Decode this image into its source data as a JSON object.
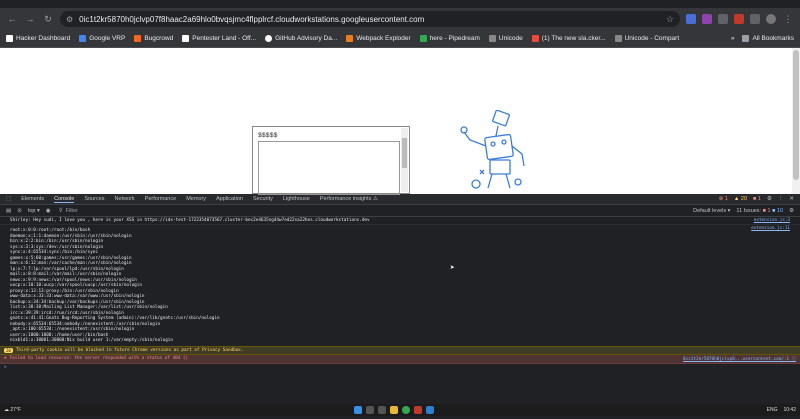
{
  "browser": {
    "url": "0ic1t2kr5870h0jclvp07f8haac2a69hlo0bvqsjmc4flpplrcf.cloudworkstations.googleusercontent.com",
    "bookmarks": [
      {
        "label": "Hacker Dashboard",
        "color": "#ffffff"
      },
      {
        "label": "Google VRP",
        "color": "#4285f4"
      },
      {
        "label": "Bugcrowd",
        "color": "#f26822"
      },
      {
        "label": "Pentester Land - Off...",
        "color": "#ffffff"
      },
      {
        "label": "GitHub Advisory Da...",
        "color": "#ffffff"
      },
      {
        "label": "Webpack Exploder",
        "color": "#e67e22"
      },
      {
        "label": "here - Pipedream",
        "color": "#34a853"
      },
      {
        "label": "Unicode",
        "color": "#888888"
      },
      {
        "label": "(1) The new sla.cker...",
        "color": "#e74c3c"
      },
      {
        "label": "Unicode - Compart",
        "color": "#888888"
      }
    ],
    "all_bookmarks": "All Bookmarks"
  },
  "page": {
    "textbox_label": "$$$$$"
  },
  "devtools": {
    "tabs": [
      "Elements",
      "Console",
      "Sources",
      "Network",
      "Performance",
      "Memory",
      "Application",
      "Security",
      "Lighthouse",
      "Performance insights ⚠"
    ],
    "active_tab": "Console",
    "counts": {
      "errors": "1",
      "warnings": "20",
      "issues_badge": "1"
    },
    "context": "top",
    "filter_placeholder": "Filter",
    "levels": "Default levels ▾",
    "issues": "11 Issues:",
    "issues_err": "1",
    "issues_info": "10",
    "log_line": "Shirley: Hey sudi, I love you , here is your XSS in https://idx-test-1722354873567.cluster-bec2e4635ng44w7ed22sa22hes.cloudworkstations.dev",
    "log_source_1": "extension.js:3",
    "log_source_2": "extension.js:11",
    "passwd": "root:x:0:0:root:/root:/bin/bash\ndaemon:x:1:1:daemon:/usr/sbin:/usr/sbin/nologin\nbin:x:2:2:bin:/bin:/usr/sbin/nologin\nsys:x:3:3:sys:/dev:/usr/sbin/nologin\nsync:x:4:65534:sync:/bin:/bin/sync\ngames:x:5:60:games:/usr/games:/usr/sbin/nologin\nman:x:6:12:man:/var/cache/man:/usr/sbin/nologin\nlp:x:7:7:lp:/var/spool/lpd:/usr/sbin/nologin\nmail:x:8:8:mail:/var/mail:/usr/sbin/nologin\nnews:x:9:9:news:/var/spool/news:/usr/sbin/nologin\nuucp:x:10:10:uucp:/var/spool/uucp:/usr/sbin/nologin\nproxy:x:13:13:proxy:/bin:/usr/sbin/nologin\nwww-data:x:33:33:www-data:/var/www:/usr/sbin/nologin\nbackup:x:34:34:backup:/var/backups:/usr/sbin/nologin\nlist:x:38:38:Mailing List Manager:/var/list:/usr/sbin/nologin\nirc:x:39:39:ircd:/run/ircd:/usr/sbin/nologin\ngnats:x:41:41:Gnats Bug-Reporting System (admin):/var/lib/gnats:/usr/sbin/nologin\nnobody:x:65534:65534:nobody:/nonexistent:/usr/sbin/nologin\n_apt:x:100:65534::/nonexistent:/usr/sbin/nologin\nuser:x:1000:1000::/home/user:/bin/bash\nnixbld1:x:30001:30000:Nix build user 1:/var/empty:/sbin/nologin",
    "warning_badge": "20",
    "warning_text": "Third-party cookie will be blocked in future Chrome versions as part of Privacy Sandbox.",
    "error_text": "Failed to load resource: the server responded with a status of 404 ()",
    "error_source": "0ic1t2kr5870h0jclvp0...usercontent.com/:1 ⓘ",
    "prompt": ">"
  },
  "taskbar": {
    "left": "27°F",
    "right": "ENG",
    "time": "10:42"
  }
}
